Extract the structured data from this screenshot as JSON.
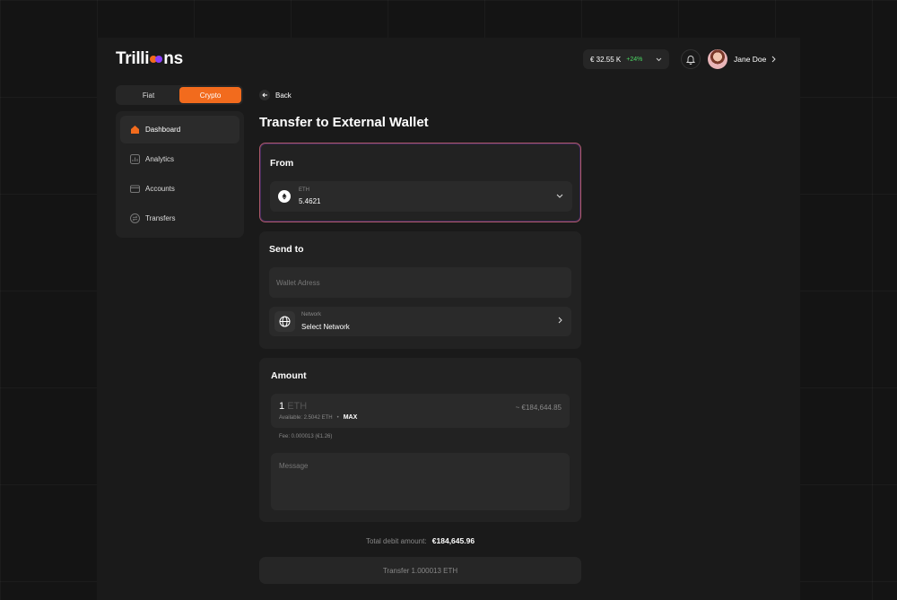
{
  "brand": {
    "prefix": "Trilli",
    "suffix": "ns"
  },
  "header": {
    "balance": "€ 32.55 K",
    "change": "+24%",
    "user_name": "Jane Doe"
  },
  "segment": {
    "fiat": "Fiat",
    "crypto": "Crypto",
    "active": "crypto"
  },
  "sidebar": {
    "items": [
      {
        "label": "Dashboard",
        "icon": "home-icon",
        "active": true
      },
      {
        "label": "Analytics",
        "icon": "chart-icon",
        "active": false
      },
      {
        "label": "Accounts",
        "icon": "wallet-icon",
        "active": false
      },
      {
        "label": "Transfers",
        "icon": "transfer-icon",
        "active": false
      }
    ]
  },
  "main": {
    "back_label": "Back",
    "title": "Transfer to External Wallet",
    "from": {
      "title": "From",
      "asset_label": "ETH",
      "asset_value": "5.4621"
    },
    "send_to": {
      "title": "Send to",
      "wallet_placeholder": "Wallet Adress",
      "network_label": "Network",
      "network_value": "Select Network"
    },
    "amount": {
      "title": "Amount",
      "value": "1",
      "unit": "ETH",
      "available": "Available: 2.5042 ETH",
      "max_label": "MAX",
      "fiat_equiv": "~ €184,644.85",
      "fee": "Fee: 0.000013 (€1.26)",
      "message_placeholder": "Message"
    },
    "debit_label": "Total debit amount:",
    "debit_value": "€184,645.96",
    "transfer_button": "Transfer 1.000013 ETH"
  },
  "colors": {
    "accent": "#f26b1d",
    "secondary": "#8b3dff",
    "positive": "#4cd964"
  }
}
